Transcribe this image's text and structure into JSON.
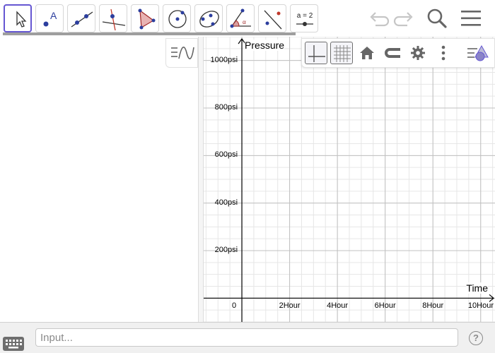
{
  "toolbar": {
    "tools": [
      {
        "name": "move-tool",
        "icon": "cursor-icon",
        "selected": true
      },
      {
        "name": "point-tool",
        "icon": "point-label-icon",
        "label": "A"
      },
      {
        "name": "line-tool",
        "icon": "line-through-points-icon"
      },
      {
        "name": "perpendicular-tool",
        "icon": "perpendicular-line-icon"
      },
      {
        "name": "polygon-tool",
        "icon": "polygon-icon"
      },
      {
        "name": "circle-tool",
        "icon": "circle-center-point-icon"
      },
      {
        "name": "ellipse-tool",
        "icon": "conic-through-points-icon"
      },
      {
        "name": "angle-tool",
        "icon": "angle-icon",
        "label": "α"
      },
      {
        "name": "reflect-tool",
        "icon": "reflect-about-line-icon"
      },
      {
        "name": "slider-tool",
        "icon": "slider-icon",
        "label": "a = 2"
      }
    ],
    "actions": [
      "undo-icon",
      "redo-icon",
      "search-icon",
      "menu-icon"
    ]
  },
  "graphics": {
    "style_bar": [
      "axes-toggle-icon",
      "grid-toggle-icon",
      "home-icon",
      "magnet-icon",
      "gear-icon",
      "more-vert-icon",
      "style-bar-toggle-icon"
    ]
  },
  "chart_data": {
    "type": "line",
    "xlabel": "Time",
    "ylabel": "Pressure",
    "x_ticks": [
      "0",
      "2Hour",
      "4Hour",
      "6Hour",
      "8Hour",
      "10Hour"
    ],
    "y_ticks": [
      "200psi",
      "400psi",
      "600psi",
      "800psi",
      "1000psi"
    ],
    "xlim": [
      -1.6,
      10.6
    ],
    "ylim": [
      -100,
      1100
    ],
    "grid": true,
    "series": []
  },
  "input_bar": {
    "placeholder": "Input...",
    "help_label": "?"
  },
  "colors": {
    "accent": "#6557d2",
    "grid_major": "#c0c0c0",
    "grid_minor": "#e6e6e6",
    "axis": "#000000"
  }
}
